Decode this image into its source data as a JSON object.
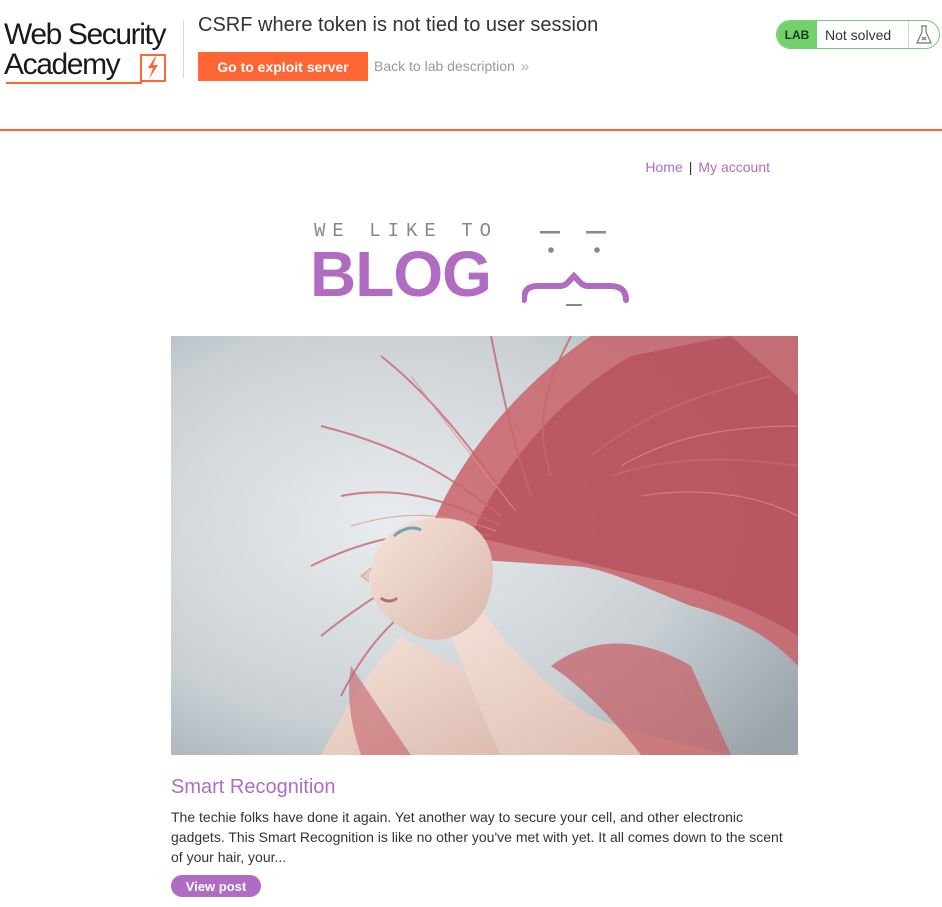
{
  "academy": {
    "logo_line1": "Web Security",
    "logo_line2": "Academy",
    "lab_title": "CSRF where token is not tied to user session",
    "exploit_button": "Go to exploit server",
    "back_link": "Back to lab description",
    "lab_badge": "LAB",
    "lab_status": "Not solved",
    "accent_color": "#ff6633",
    "status_color": "#70d16d"
  },
  "nav": {
    "home": "Home",
    "separator": "|",
    "my_account": "My account"
  },
  "blog_header": {
    "tagline": "WE LIKE TO",
    "word": "BLOG",
    "brand_color": "#b06cc3"
  },
  "post": {
    "image_icon": "woman-with-flowing-pink-hair-photo",
    "title": "Smart Recognition",
    "summary": "The techie folks have done it again. Yet another way to secure your cell, and other electronic gadgets. This Smart Recognition is like no other you've met with yet. It all comes down to the scent of your hair, your...",
    "view_button": "View post"
  }
}
